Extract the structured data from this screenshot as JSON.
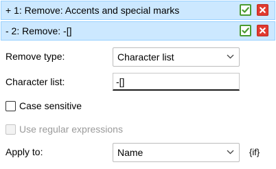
{
  "rules": [
    {
      "label": "+ 1: Remove: Accents and special marks"
    },
    {
      "label": "-  2: Remove: -[]"
    }
  ],
  "form": {
    "remove_type_label": "Remove type:",
    "remove_type_value": "Character list",
    "character_list_label": "Character list:",
    "character_list_value": "-[]",
    "case_sensitive_label": "Case sensitive",
    "case_sensitive_checked": false,
    "regex_label": "Use regular expressions",
    "regex_checked": false,
    "regex_enabled": false,
    "apply_to_label": "Apply to:",
    "apply_to_value": "Name",
    "if_label": "{if}"
  },
  "colors": {
    "header_bg": "#cce8ff",
    "header_border": "#99d1ff",
    "check_green": "#4a9b2f",
    "delete_red": "#e03a2f"
  },
  "icons": [
    "check-icon",
    "close-icon",
    "chevron-down-icon"
  ]
}
